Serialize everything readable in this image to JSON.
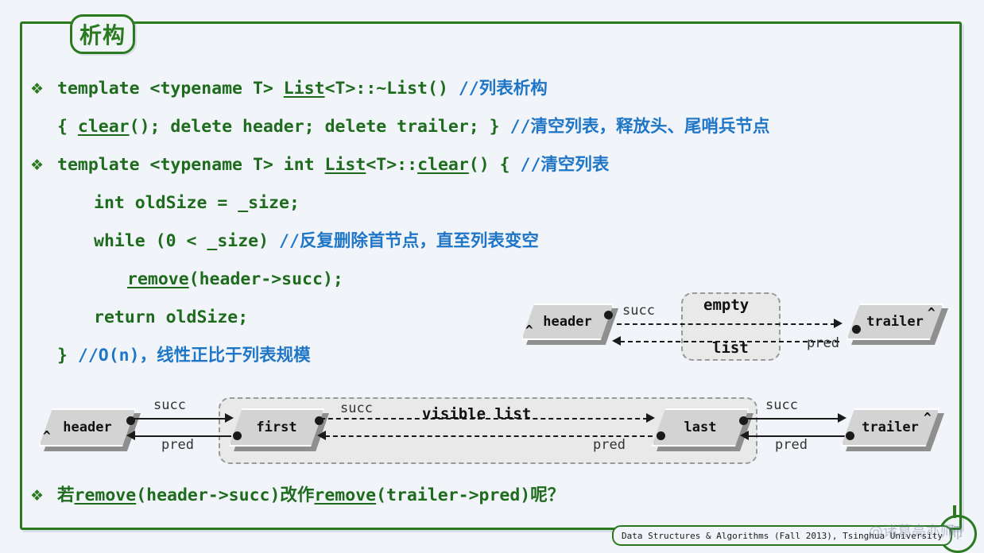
{
  "slide": {
    "title": "析构",
    "background_color": "#f1f5fa",
    "frame_color": "#2b7a20"
  },
  "code": {
    "bullet_glyph": "❖",
    "lines": [
      {
        "bullet": true,
        "indent": 0,
        "segments": [
          {
            "text": "template <typename T> ",
            "style": "grn"
          },
          {
            "text": "List",
            "style": "grn-u"
          },
          {
            "text": "<T>::~List() ",
            "style": "grn"
          },
          {
            "text": "//",
            "style": "cmt"
          },
          {
            "text": "列表析构",
            "style": "cmt-cn"
          }
        ]
      },
      {
        "bullet": false,
        "indent": 1,
        "segments": [
          {
            "text": "{  ",
            "style": "grn"
          },
          {
            "text": "clear",
            "style": "grn-u"
          },
          {
            "text": "(); delete header; delete trailer; } ",
            "style": "grn"
          },
          {
            "text": "//",
            "style": "cmt"
          },
          {
            "text": "清空列表，释放头、尾哨兵节点",
            "style": "cmt-cn"
          }
        ]
      },
      {
        "bullet": true,
        "indent": 0,
        "segments": [
          {
            "text": "template <typename T> int ",
            "style": "grn"
          },
          {
            "text": "List",
            "style": "grn-u"
          },
          {
            "text": "<T>::",
            "style": "grn"
          },
          {
            "text": "clear",
            "style": "grn-u"
          },
          {
            "text": "() { ",
            "style": "grn"
          },
          {
            "text": "//",
            "style": "cmt"
          },
          {
            "text": "清空列表",
            "style": "cmt-cn"
          }
        ]
      },
      {
        "bullet": false,
        "indent": 2,
        "segments": [
          {
            "text": "int oldSize = _size;",
            "style": "grn"
          }
        ]
      },
      {
        "bullet": false,
        "indent": 2,
        "segments": [
          {
            "text": "while (0 < _size) ",
            "style": "grn"
          },
          {
            "text": "//",
            "style": "cmt"
          },
          {
            "text": "反复删除首节点，直至列表变空",
            "style": "cmt-cn"
          }
        ]
      },
      {
        "bullet": false,
        "indent": 3,
        "segments": [
          {
            "text": "remove",
            "style": "grn-u"
          },
          {
            "text": "(header->succ);",
            "style": "grn"
          }
        ]
      },
      {
        "bullet": false,
        "indent": 2,
        "segments": [
          {
            "text": "return oldSize;",
            "style": "grn"
          }
        ]
      },
      {
        "bullet": false,
        "indent": 1,
        "segments": [
          {
            "text": "} ",
            "style": "grn"
          },
          {
            "text": "//O(n)",
            "style": "cmt"
          },
          {
            "text": "，线性正比于列表规模",
            "style": "cmt-cn"
          }
        ]
      }
    ],
    "question_line": {
      "bullet": true,
      "segments": [
        {
          "text": "若",
          "style": "grn-cn"
        },
        {
          "text": "remove",
          "style": "grn-u"
        },
        {
          "text": "(header->succ)",
          "style": "grn"
        },
        {
          "text": "改作",
          "style": "grn-cn"
        },
        {
          "text": "remove",
          "style": "grn-u"
        },
        {
          "text": "(trailer->pred)",
          "style": "grn"
        },
        {
          "text": "呢？",
          "style": "grn-cn"
        }
      ]
    }
  },
  "diagram_empty": {
    "nodes": [
      {
        "label": "header",
        "caret": "^"
      },
      {
        "label": "trailer",
        "caret": "^"
      }
    ],
    "group_label_top": "empty",
    "group_label_bottom": "list",
    "edge_labels": {
      "succ": "succ",
      "pred": "pred"
    }
  },
  "diagram_visible": {
    "nodes": [
      {
        "label": "header",
        "caret": "^"
      },
      {
        "label": "first",
        "caret": ""
      },
      {
        "label": "last",
        "caret": ""
      },
      {
        "label": "trailer",
        "caret": "^"
      }
    ],
    "group_label": "visible list",
    "edge_labels": {
      "succ1": "succ",
      "pred1": "pred",
      "succ2": "succ",
      "pred2": "pred",
      "succ3": "succ",
      "pred3": "pred"
    }
  },
  "footer": {
    "text": "Data Structures & Algorithms (Fall 2013), Tsinghua University",
    "watermark": "@诸葛亮亦师",
    "watermark_glyph": "师"
  }
}
